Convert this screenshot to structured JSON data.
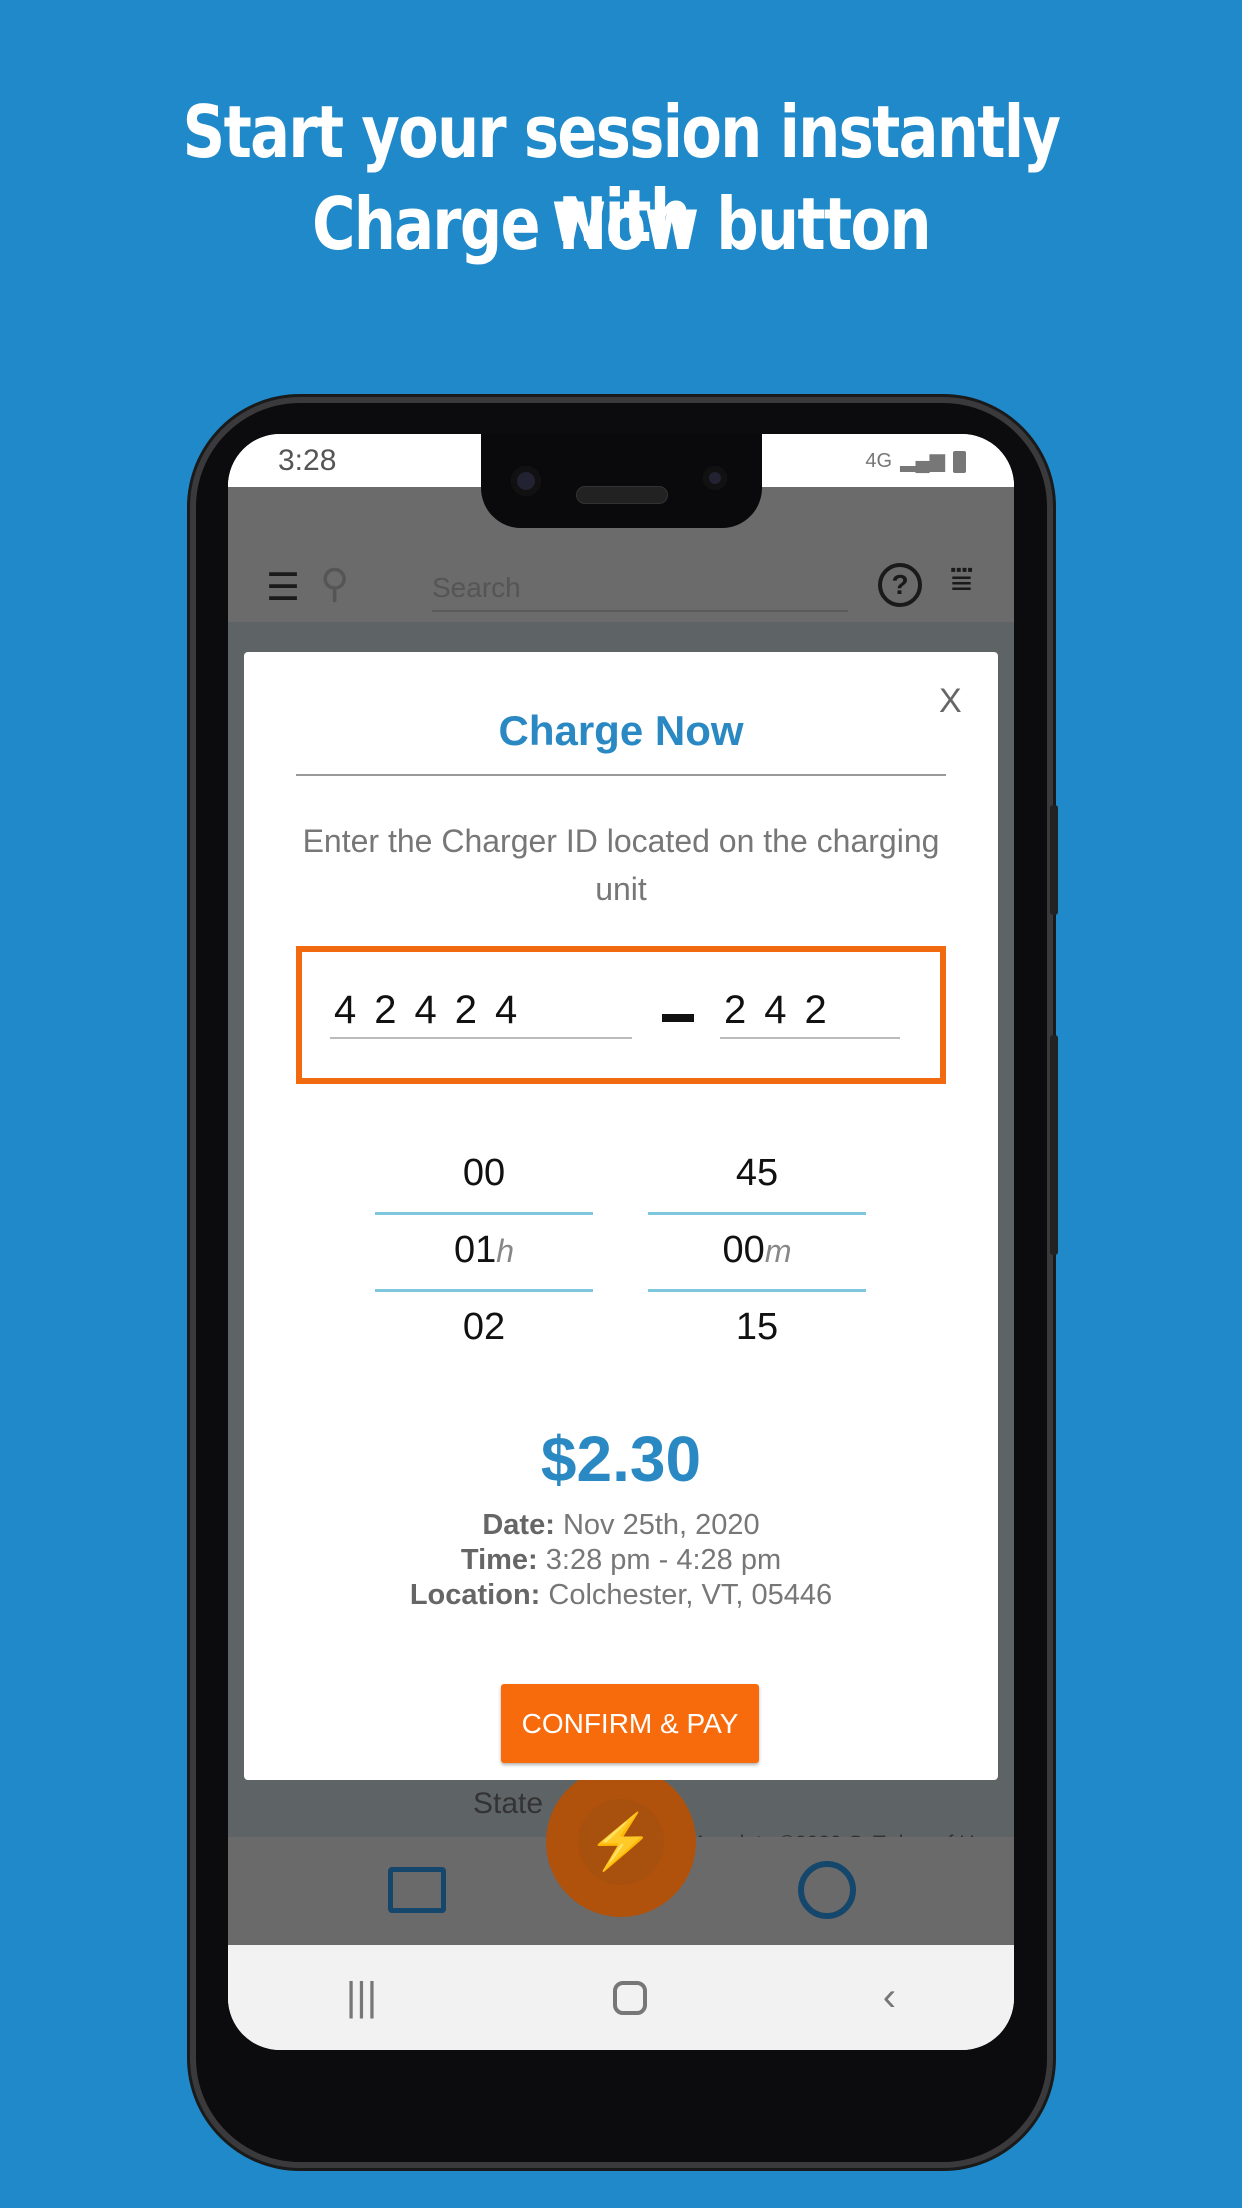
{
  "headline": {
    "line1": "Start your session instantly with",
    "line2": "Charge Now button"
  },
  "status_bar": {
    "time": "3:28",
    "network": "4G"
  },
  "app_bar": {
    "search_placeholder": "Search"
  },
  "map": {
    "copyright": "Map data ©2020 Google",
    "terms": "Terms of Use",
    "place": "State"
  },
  "modal": {
    "title": "Charge Now",
    "close_label": "X",
    "instruction": "Enter the Charger ID located on the charging unit",
    "charger_id": {
      "part1": "42424",
      "part2": "242"
    },
    "hours": {
      "prev": "00",
      "selected": "01",
      "next": "02",
      "unit": "h"
    },
    "minutes": {
      "prev": "45",
      "selected": "00",
      "next": "15",
      "unit": "m"
    },
    "price": "$2.30",
    "details": {
      "date_label": "Date:",
      "date": "Nov 25th, 2020",
      "time_label": "Time:",
      "time": "3:28 pm - 4:28 pm",
      "location_label": "Location:",
      "location": "Colchester, VT, 05446"
    },
    "confirm_label": "CONFIRM & PAY"
  },
  "colors": {
    "background": "#1f89c9",
    "accent_blue": "#2a88c3",
    "accent_orange": "#f76b0c"
  }
}
